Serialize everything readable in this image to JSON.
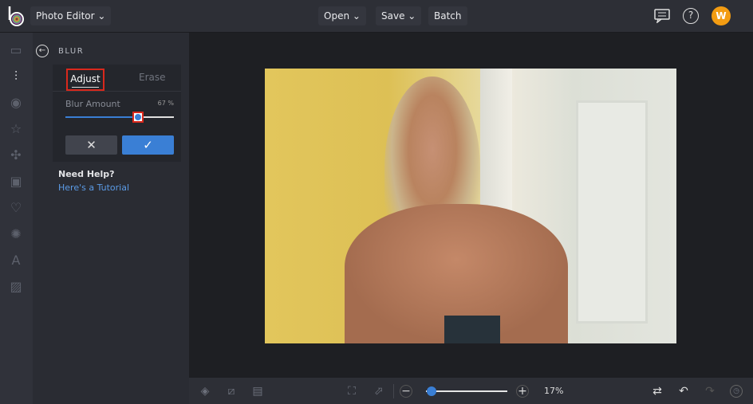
{
  "header": {
    "app_menu": "Photo Editor",
    "open": "Open",
    "save": "Save",
    "batch": "Batch",
    "avatar_initial": "W"
  },
  "panel": {
    "title": "BLUR",
    "tabs": [
      {
        "label": "Adjust",
        "active": true
      },
      {
        "label": "Erase",
        "active": false
      }
    ],
    "slider_label": "Blur Amount",
    "slider_value_text": "67 %",
    "slider_value": 67,
    "help_title": "Need Help?",
    "help_link": "Here's a Tutorial"
  },
  "bottom": {
    "zoom_text": "17%",
    "zoom_value": 17
  },
  "colors": {
    "accent": "#3a7fd5",
    "highlight": "#d9281c",
    "avatar": "#f39c12"
  }
}
